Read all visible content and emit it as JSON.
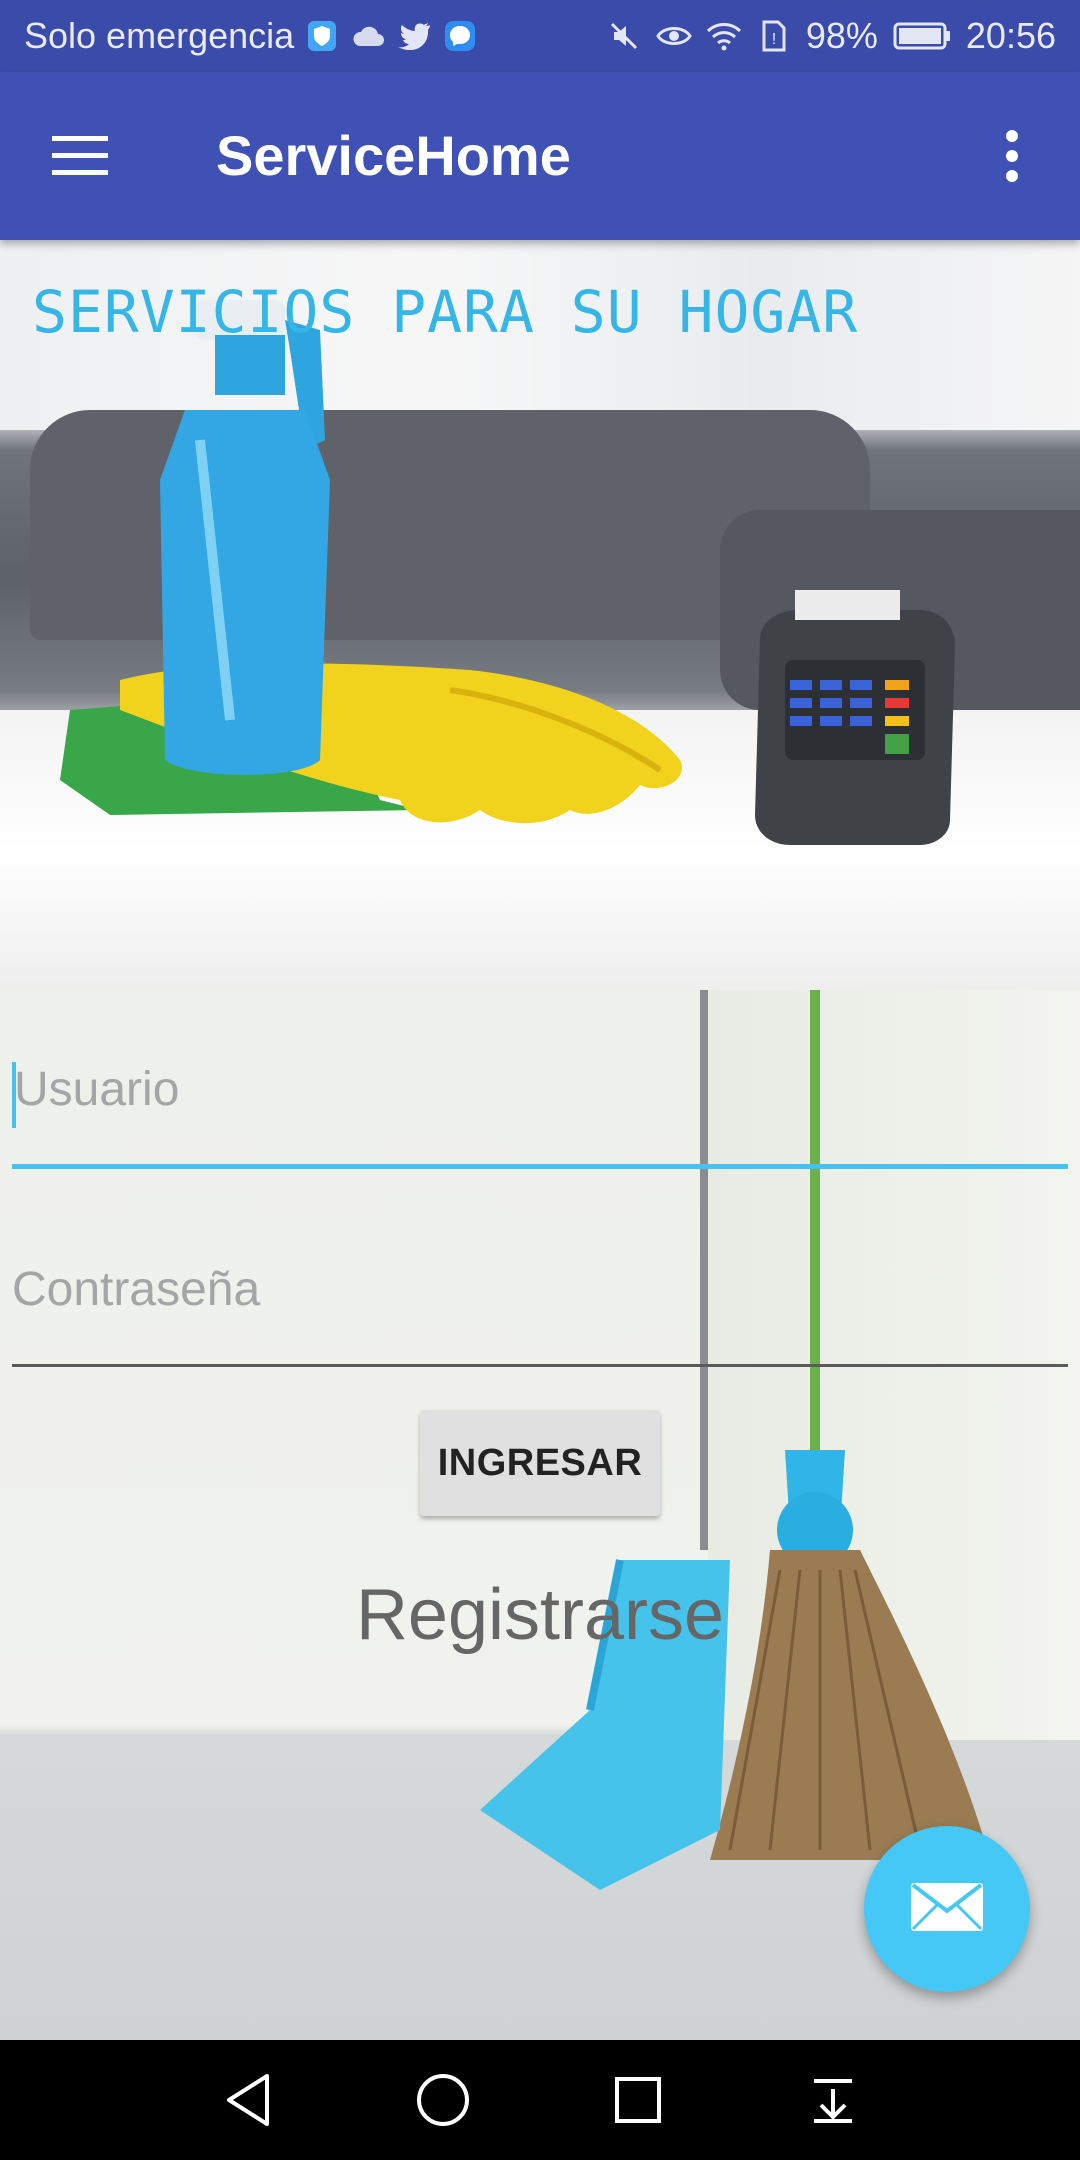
{
  "status_bar": {
    "carrier": "Solo emergencia",
    "battery": "98%",
    "time": "20:56",
    "icons": [
      "shield-icon",
      "cloud-icon",
      "twitter-icon",
      "messenger-icon",
      "mute-icon",
      "eye-icon",
      "wifi-icon",
      "sim-icon",
      "battery-icon"
    ]
  },
  "app_bar": {
    "title": "ServiceHome",
    "menu_icon": "hamburger-icon",
    "overflow_icon": "more-vert-icon"
  },
  "hero": {
    "heading": "SERVICIOS PARA SU HOGAR"
  },
  "login": {
    "username_placeholder": "Usuario",
    "password_placeholder": "Contraseña",
    "submit_label": "INGRESAR",
    "register_label": "Registrarse"
  },
  "fab": {
    "icon": "mail-icon"
  },
  "nav_bar": {
    "icons": [
      "back-icon",
      "home-icon",
      "recents-icon",
      "notifications-pull-icon"
    ]
  },
  "colors": {
    "primary": "#3f51b5",
    "status_bar": "#3a4baa",
    "accent": "#45c2f0",
    "heading": "#35b6e6"
  }
}
